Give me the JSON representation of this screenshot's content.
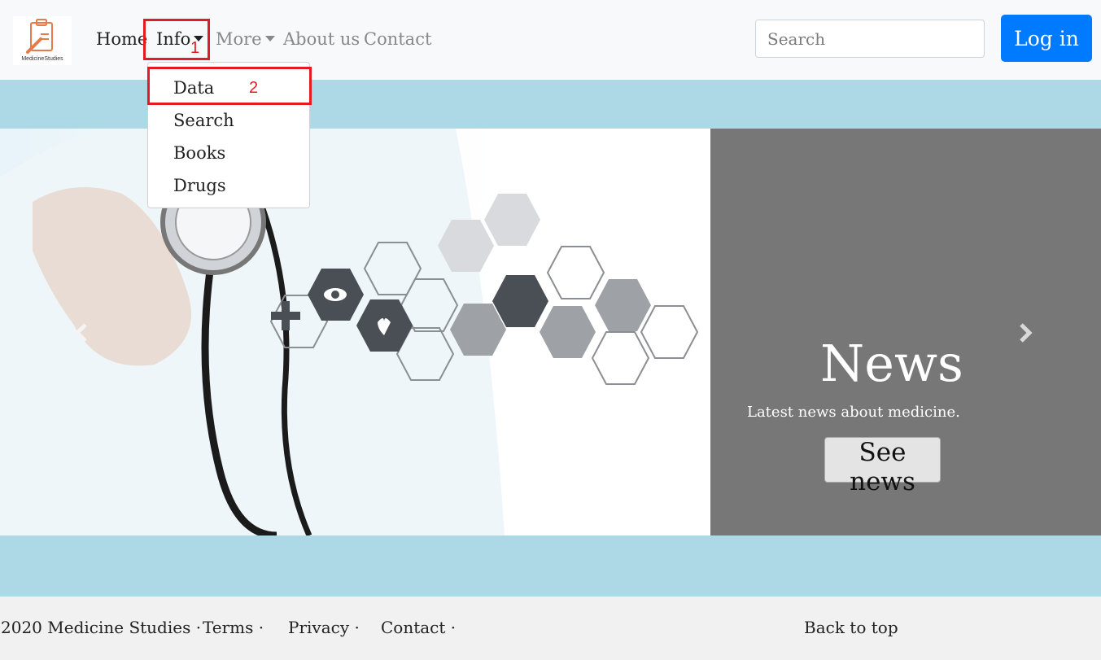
{
  "brand": {
    "logo_text": "MedicineStudies",
    "logo_icon": "clipboard-medicine-icon"
  },
  "nav": {
    "home": "Home",
    "info": "Info",
    "more": "More",
    "about": "About us",
    "contact": "Contact"
  },
  "search": {
    "placeholder": "Search"
  },
  "login_label": "Log in",
  "dropdown": {
    "items": [
      "Data",
      "Search",
      "Books",
      "Drugs"
    ]
  },
  "annotations": {
    "first": "1",
    "second": "2",
    "color": "#e31b23"
  },
  "carousel": {
    "title": "News",
    "subtitle": "Latest news about medicine.",
    "button": "See news",
    "prev_icon": "chevron-left-icon",
    "next_icon": "chevron-right-icon"
  },
  "footer": {
    "copyright": "2020 Medicine Studies ·",
    "terms": "Terms ·",
    "privacy": "Privacy ·",
    "contact": "Contact ·",
    "back_to_top": "Back to top"
  },
  "colors": {
    "primary": "#007bff",
    "band": "#add8e6",
    "panel": "#777777",
    "navbar": "#f8f9fa"
  }
}
